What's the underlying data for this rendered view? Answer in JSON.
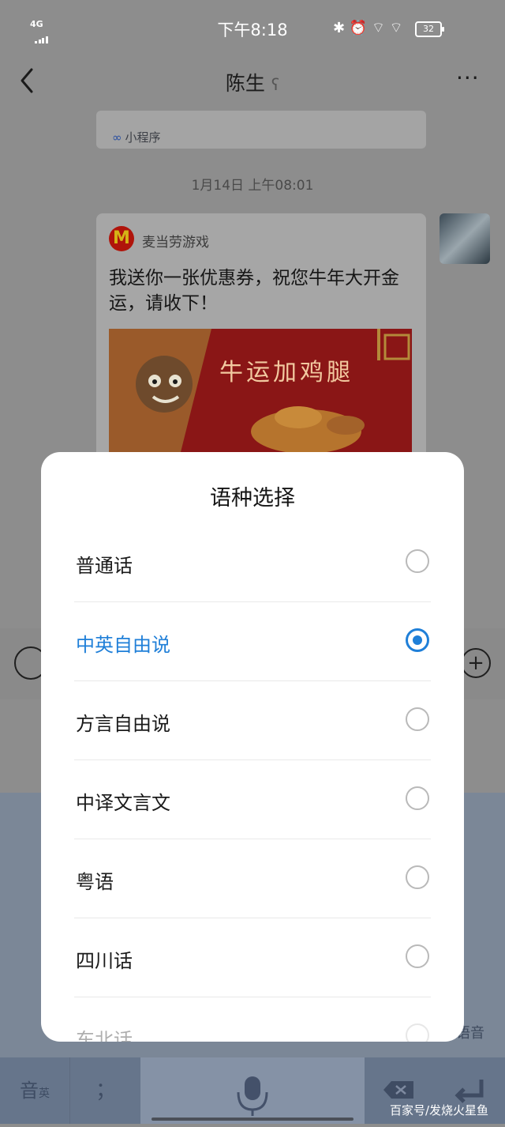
{
  "status_bar": {
    "network": "4G",
    "time": "下午8:18",
    "battery": "32",
    "icons": "✱ ⏰ ⌔ ⌔"
  },
  "nav": {
    "title": "陈生",
    "ear_icon": "ear-icon",
    "more": "···"
  },
  "chat": {
    "mini_program_label": "小程序",
    "timestamp": "1月14日 上午08:01",
    "card": {
      "sender": "麦当劳游戏",
      "logo_letter": "M",
      "message": "我送你一张优惠券，祝您牛年大开金运，请收下！",
      "banner_text": "牛运加鸡腿"
    }
  },
  "input": {
    "keyboard_lang": "音",
    "keyboard_lang_sub": "英",
    "semicolon": "；",
    "voice_hint": "语音"
  },
  "dialog": {
    "title": "语种选择",
    "options": [
      {
        "label": "普通话",
        "selected": false
      },
      {
        "label": "中英自由说",
        "selected": true
      },
      {
        "label": "方言自由说",
        "selected": false
      },
      {
        "label": "中译文言文",
        "selected": false
      },
      {
        "label": "粤语",
        "selected": false
      },
      {
        "label": "四川话",
        "selected": false
      },
      {
        "label": "东北话",
        "selected": false
      }
    ]
  },
  "watermark": "百家号/发烧火星鱼",
  "colors": {
    "accent": "#1f7fd8",
    "overlay": "#8d8d8d",
    "dialog_bg": "#ffffff"
  }
}
